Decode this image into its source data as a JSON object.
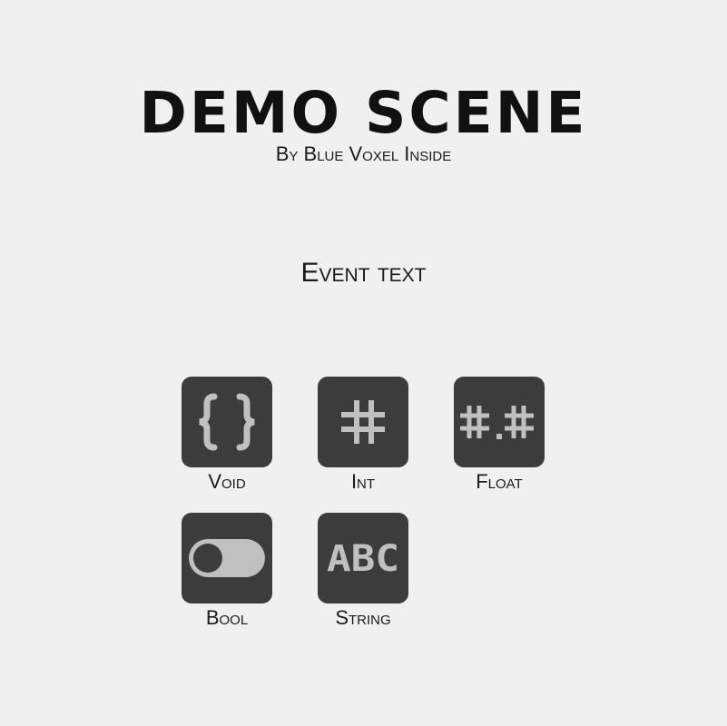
{
  "header": {
    "title": "DEMO SCENE",
    "subtitle": "By Blue Voxel Inside"
  },
  "event": {
    "text": "Event text"
  },
  "buttons": [
    {
      "label": "Void",
      "icon": "curly-braces-icon"
    },
    {
      "label": "Int",
      "icon": "hash-icon"
    },
    {
      "label": "Float",
      "icon": "float-hash-icon"
    },
    {
      "label": "Bool",
      "icon": "toggle-icon"
    },
    {
      "label": "String",
      "icon": "abc-text-icon",
      "icon_text": "ABC"
    }
  ],
  "colors": {
    "background": "#f0f0f0",
    "button": "#3c3c3c",
    "icon": "#c0c0c0",
    "text": "#111111"
  }
}
